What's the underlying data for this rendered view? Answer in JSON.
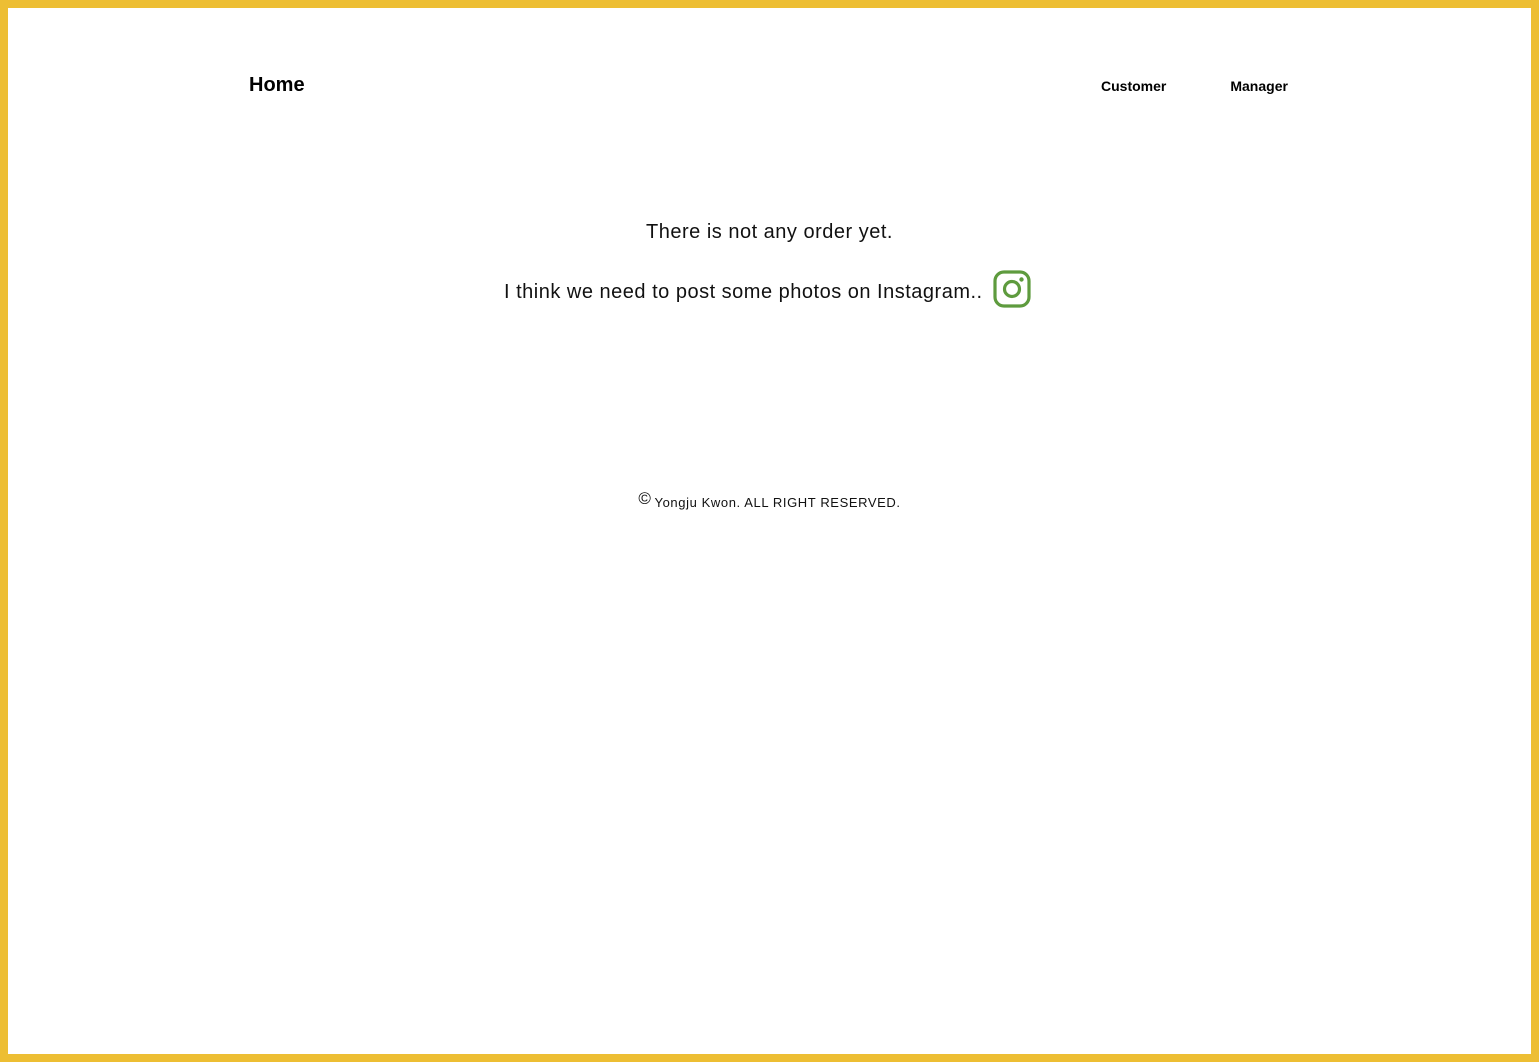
{
  "nav": {
    "home_label": "Home",
    "links": [
      {
        "label": "Customer"
      },
      {
        "label": "Manager"
      }
    ]
  },
  "main": {
    "empty_message": "There is not any order yet.",
    "instagram_message": "I think we need to post some photos on Instagram..",
    "instagram_icon": "instagram-icon"
  },
  "footer": {
    "copyright_symbol": "©",
    "text": "Yongju Kwon. ALL RIGHT RESERVED."
  },
  "colors": {
    "border": "#EDBE33",
    "instagram_icon": "#5E9B3E"
  }
}
